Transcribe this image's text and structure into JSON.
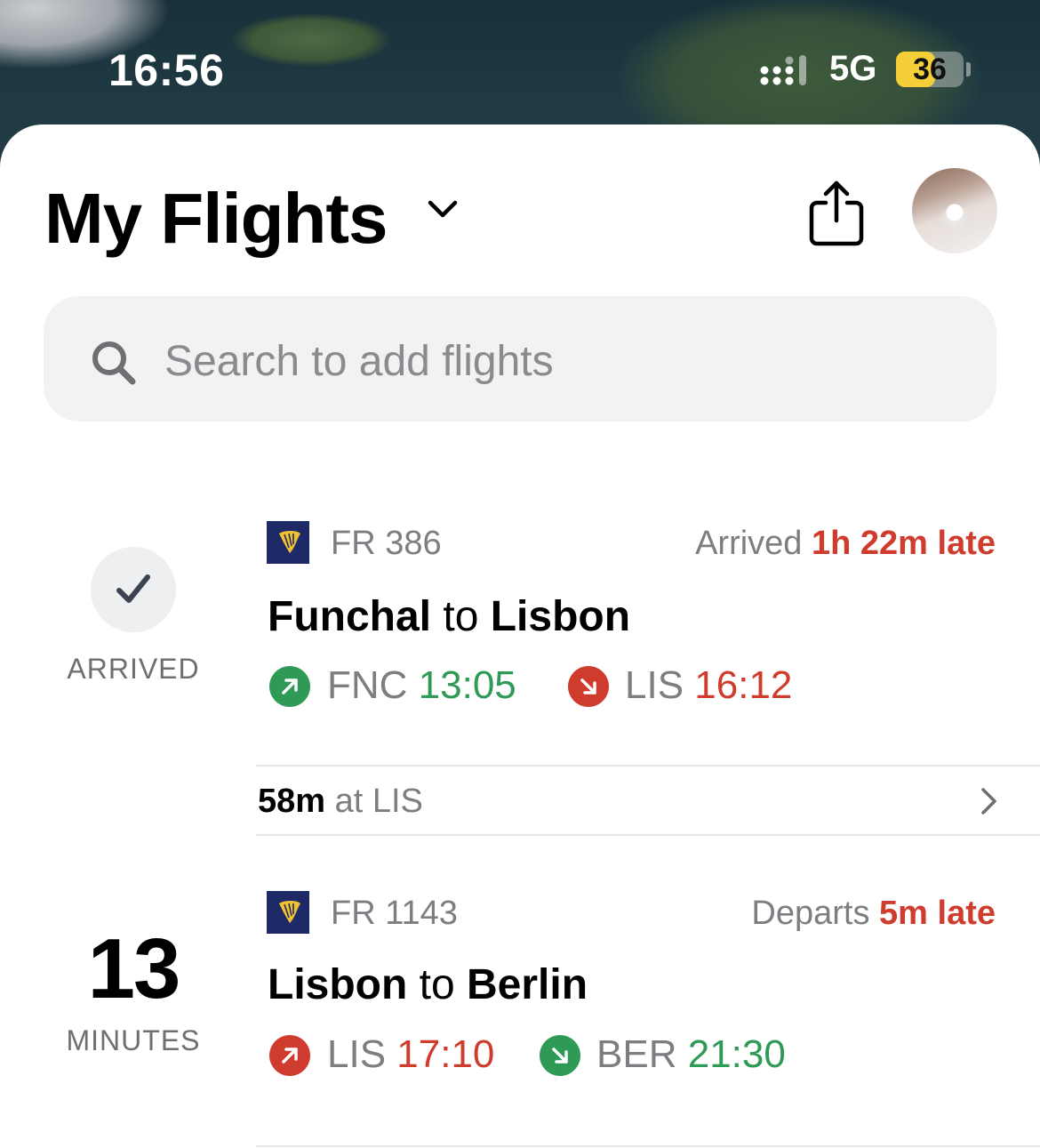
{
  "status_bar": {
    "time": "16:56",
    "network": "5G",
    "battery": "36",
    "battery_level": 0.36
  },
  "header": {
    "title": "My Flights"
  },
  "search": {
    "placeholder": "Search to add flights"
  },
  "flights": [
    {
      "status_label": "ARRIVED",
      "flight_number": "FR 386",
      "status_prefix": "Arrived ",
      "status_delay": "1h 22m late",
      "route_from": "Funchal",
      "route_to_word": " to ",
      "route_to": "Lisbon",
      "departure": {
        "code": "FNC",
        "time": "13:05",
        "color": "#2f9a56"
      },
      "arrival": {
        "code": "LIS",
        "time": "16:12",
        "color": "#cf3b2c"
      }
    },
    {
      "countdown_value": "13",
      "countdown_unit": "MINUTES",
      "flight_number": "FR 1143",
      "status_prefix": "Departs ",
      "status_delay": "5m late",
      "route_from": "Lisbon",
      "route_to_word": " to ",
      "route_to": "Berlin",
      "departure": {
        "code": "LIS",
        "time": "17:10",
        "color": "#cf3b2c"
      },
      "arrival": {
        "code": "BER",
        "time": "21:30",
        "color": "#2f9a56"
      }
    }
  ],
  "layover": {
    "duration": "58m",
    "location": " at LIS"
  },
  "icons": {
    "title_chevron": "chevron-down-icon",
    "share": "share-icon",
    "search": "search-icon",
    "status_check": "checkmark-icon",
    "departure": "arrow-up-right-icon",
    "arrival": "arrow-down-right-icon",
    "layover_chevron": "chevron-right-icon"
  }
}
